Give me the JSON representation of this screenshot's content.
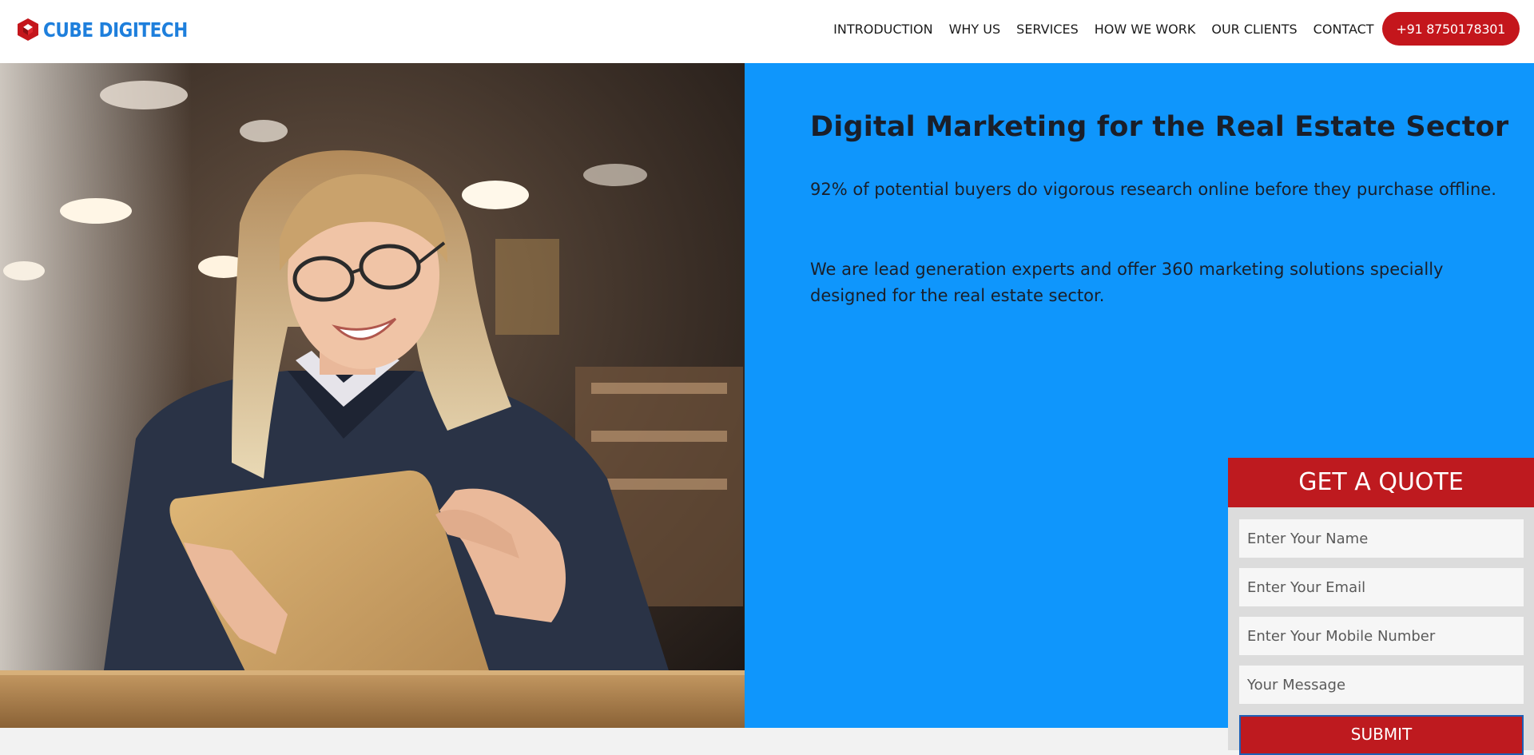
{
  "brand": {
    "name": "CUBE DIGITECH",
    "logo_icon": "cube-hexagon-icon",
    "color": "#1e7fdc"
  },
  "nav": {
    "items": [
      "INTRODUCTION",
      "WHY US",
      "SERVICES",
      "HOW WE WORK",
      "OUR CLIENTS",
      "CONTACT"
    ],
    "phone": "+91 8750178301"
  },
  "hero": {
    "title": "Digital Marketing for the Real Estate Sector",
    "paragraph1": "92% of potential buyers do vigorous research online before they purchase offline.",
    "paragraph2": "We are lead generation experts and offer 360 marketing solutions specially designed for the real estate sector.",
    "image_alt": "woman-with-tablet-photo",
    "panel_color": "#0f96fc"
  },
  "quote_form": {
    "title": "GET A QUOTE",
    "name_placeholder": "Enter Your Name",
    "email_placeholder": "Enter Your Email",
    "mobile_placeholder": "Enter Your Mobile Number",
    "message_placeholder": "Your Message",
    "submit_label": "SUBMIT",
    "accent": "#be1a1f"
  }
}
